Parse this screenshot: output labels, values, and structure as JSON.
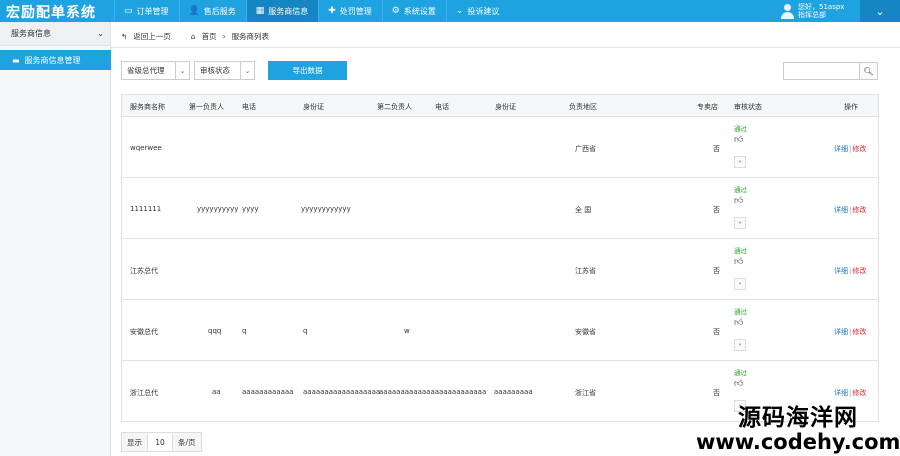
{
  "app": {
    "title": "宏励配单系统"
  },
  "nav": {
    "items": [
      {
        "label": "订单管理",
        "icon": "monitor-icon"
      },
      {
        "label": "售后服务",
        "icon": "user-icon"
      },
      {
        "label": "服务商信息",
        "icon": "grid-icon"
      },
      {
        "label": "处罚管理",
        "icon": "puzzle-icon"
      },
      {
        "label": "系统设置",
        "icon": "gear-icon"
      },
      {
        "label": "投诉建议",
        "icon": "chevron-down-icon"
      }
    ],
    "active_index": 2
  },
  "user": {
    "greeting": "您好，51aspx",
    "role": "指挥总部"
  },
  "sidebar": {
    "group_label": "服务商信息",
    "items": [
      {
        "label": "服务商信息管理",
        "active": true
      }
    ]
  },
  "breadcrumb": {
    "back_label": "返回上一页",
    "home_label": "首页",
    "current_label": "服务商列表"
  },
  "filters": {
    "level_select": "省级总代理",
    "status_select": "审核状态",
    "export_label": "导出数据",
    "search_placeholder": ""
  },
  "table": {
    "columns": [
      "服务商名称",
      "第一负责人",
      "电话",
      "身份证",
      "第二负责人",
      "电话",
      "身份证",
      "负责地区",
      "专卖店",
      "审核状态",
      "操作"
    ],
    "status_label": "通过",
    "detail_label": "详细",
    "edit_label": "修改",
    "rows": [
      {
        "name": "wqerwee",
        "person1": "",
        "phone1": "",
        "id1": "",
        "person2": "",
        "phone2": "",
        "id2": "",
        "region": "广西省",
        "store": "否"
      },
      {
        "name": "1111111",
        "person1": "yyyyyyyyyy",
        "phone1": "yyyy",
        "id1": "yyyyyyyyyyyy",
        "person2": "",
        "phone2": "",
        "id2": "",
        "region": "全  国",
        "store": "否"
      },
      {
        "name": "江苏总代",
        "person1": "",
        "phone1": "",
        "id1": "",
        "person2": "",
        "phone2": "",
        "id2": "",
        "region": "江苏省",
        "store": "否"
      },
      {
        "name": "安徽总代",
        "person1": "qqq",
        "phone1": "q",
        "id1": "q",
        "person2": "w",
        "phone2": "",
        "id2": "",
        "region": "安徽省",
        "store": "否"
      },
      {
        "name": "浙江总代",
        "person1": "aa",
        "phone1": "aaaaaaaaaaaa",
        "id1": "aaaaaaaaaaaaaaaaaa",
        "person2": "aaaaaaaaaaaaaaaaaaaaaaaaa",
        "phone2": "",
        "id2": "aaaaaaaaa",
        "region": "浙江省",
        "store": "否"
      }
    ]
  },
  "pager": {
    "show_label": "显示",
    "page_size": "10",
    "unit_label": "条/页"
  },
  "watermark": {
    "line1": "源码海洋网",
    "line2": "www.codehy.com"
  }
}
